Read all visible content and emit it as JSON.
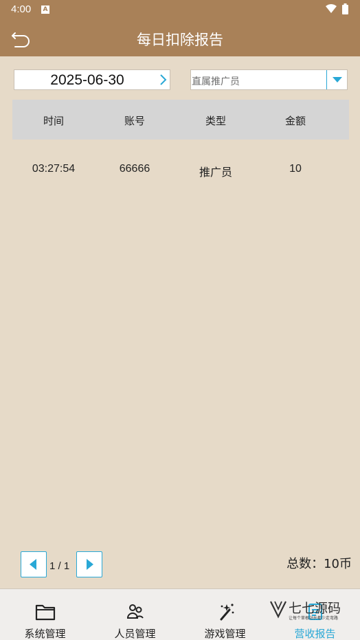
{
  "status_bar": {
    "time": "4:00",
    "notification_letter": "A"
  },
  "app_bar": {
    "title": "每日扣除报告",
    "back_icon": "undo-arrow-icon"
  },
  "filters": {
    "date": "2025-06-30",
    "agent_select_value": "直属推广员"
  },
  "table": {
    "headers": [
      "时间",
      "账号",
      "类型",
      "金额"
    ],
    "rows": [
      {
        "time": "03:27:54",
        "account": "66666",
        "type": "推广员",
        "amount": "10"
      }
    ]
  },
  "pager": {
    "page_text": "1 / 1",
    "total_text": "总数：10币"
  },
  "bottom_nav": {
    "items": [
      {
        "label": "系统管理",
        "icon": "folder-icon"
      },
      {
        "label": "人员管理",
        "icon": "people-icon"
      },
      {
        "label": "游戏管理",
        "icon": "magic-wand-icon"
      },
      {
        "label": "营收报告",
        "icon": "report-icon"
      }
    ],
    "active_index": 3
  },
  "watermark": {
    "title": "七七源码",
    "subtitle": "让每个草根站长都少走弯路"
  },
  "colors": {
    "brand": "#a98158",
    "background": "#e6dac8",
    "accent": "#29a8d6"
  }
}
